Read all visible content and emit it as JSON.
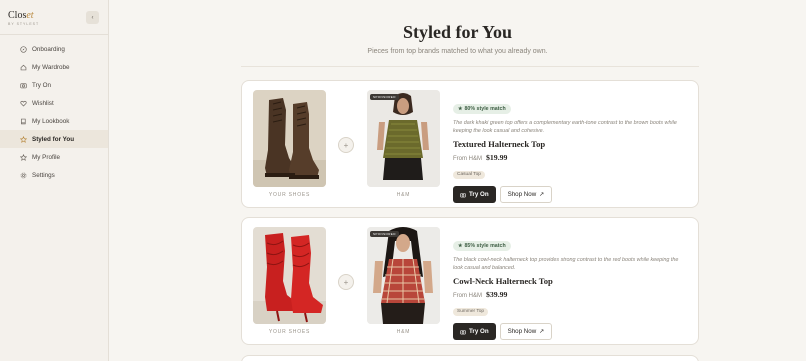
{
  "brand": {
    "name_main": "Clos",
    "name_accent": "et",
    "sub": "BY STYLEST",
    "collapse_label": "‹"
  },
  "nav": {
    "items": [
      {
        "label": "Onboarding",
        "icon": "compass-icon"
      },
      {
        "label": "My Wardrobe",
        "icon": "home-icon"
      },
      {
        "label": "Try On",
        "icon": "camera-icon"
      },
      {
        "label": "Wishlist",
        "icon": "heart-icon"
      },
      {
        "label": "My Lookbook",
        "icon": "book-icon"
      },
      {
        "label": "Styled for You",
        "icon": "star-icon",
        "active": true
      },
      {
        "label": "My Profile",
        "icon": "star-outline-icon"
      },
      {
        "label": "Settings",
        "icon": "gear-icon"
      }
    ]
  },
  "page": {
    "title": "Styled for You",
    "subtitle": "Pieces from top brands matched to what you already own."
  },
  "cards": [
    {
      "shoe_label": "YOUR SHOES",
      "sponsored": "SPONSORED",
      "brand_label": "H&M",
      "match": "80% style match",
      "description": "The dark khaki green top offers a complementary earth-tone contrast to the brown boots while keeping the look casual and cohesive.",
      "name": "Textured Halterneck Top",
      "price_from": "From H&M",
      "price": "$19.99",
      "tag": "Casual Top",
      "try_label": "Try On",
      "shop_label": "Shop Now"
    },
    {
      "shoe_label": "YOUR SHOES",
      "sponsored": "SPONSORED",
      "brand_label": "H&M",
      "match": "85% style match",
      "description": "The black cowl-neck halterneck top provides strong contrast to the red boots while keeping the look casual and balanced.",
      "name": "Cowl-Neck Halterneck Top",
      "price_from": "From H&M",
      "price": "$39.99",
      "tag": "Summer Top",
      "try_label": "Try On",
      "shop_label": "Shop Now"
    }
  ]
}
